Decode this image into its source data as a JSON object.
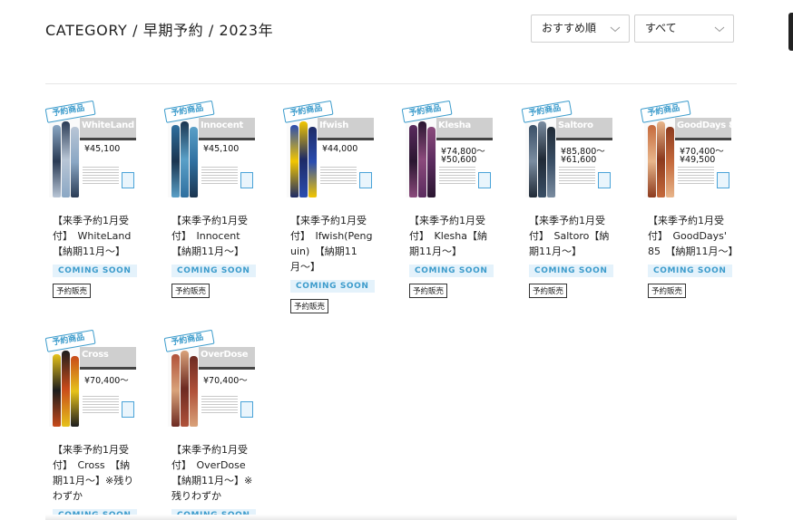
{
  "page": {
    "title": "CATEGORY / 早期予約 / 2023年",
    "sort_label": "おすすめ順",
    "filter_label": "すべて"
  },
  "labels": {
    "badge": "予約商品",
    "coming_soon": "COMING SOON",
    "presale": "予約販売"
  },
  "colors": {
    "accent": "#3d9ccc",
    "coming_bg": "#e4f2fb"
  },
  "products": [
    {
      "title": "【来季予約1月受付】　WhiteLand【納期11月〜】",
      "img_name": "WhiteLand",
      "price": "¥45,100",
      "price2": "",
      "show_coming": true,
      "show_presale": true
    },
    {
      "title": "【来季予約1月受付】　Innocent【納期11月〜】",
      "img_name": "Innocent",
      "price": "¥45,100",
      "price2": "",
      "show_coming": true,
      "show_presale": true
    },
    {
      "title": "【来季予約1月受付】　Ifwish(Penguin)　【納期11月〜】",
      "img_name": "Ifwish",
      "price": "¥44,000",
      "price2": "",
      "show_coming": true,
      "show_presale": true
    },
    {
      "title": "【来季予約1月受付】　Klesha【納期11月〜】",
      "img_name": "Klesha",
      "price": "¥74,800〜",
      "price2": "¥50,600",
      "show_coming": true,
      "show_presale": true
    },
    {
      "title": "【来季予約1月受付】　Saltoro【納期11月〜】",
      "img_name": "Saltoro",
      "price": "¥85,800〜",
      "price2": "¥61,600",
      "show_coming": true,
      "show_presale": true
    },
    {
      "title": "【来季予約1月受付】　GoodDays' 85　【納期11月〜】",
      "img_name": "GoodDays 85",
      "price": "¥70,400〜",
      "price2": "¥49,500",
      "show_coming": true,
      "show_presale": true
    },
    {
      "title": "【来季予約1月受付】　Cross　【納期11月〜】※残りわずか",
      "img_name": "Cross",
      "price": "¥70,400〜",
      "price2": "",
      "show_coming": true,
      "show_presale": false
    },
    {
      "title": "【来季予約1月受付】　OverDose【納期11月〜】※残りわずか",
      "img_name": "OverDose",
      "price": "¥70,400〜",
      "price2": "",
      "show_coming": true,
      "show_presale": false
    }
  ]
}
